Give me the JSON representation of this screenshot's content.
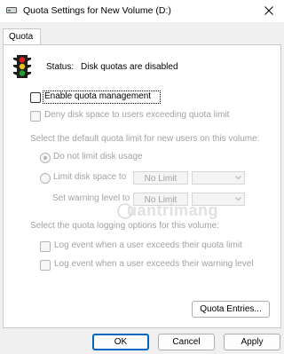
{
  "window": {
    "title": "Quota Settings for New Volume (D:)",
    "close_glyph": "✕",
    "title_icon": "drive-icon",
    "close_icon": "close-icon"
  },
  "tabs": [
    {
      "label": "Quota",
      "selected": true
    }
  ],
  "status": {
    "label": "Status:",
    "value": "Disk quotas are disabled",
    "icon": "traffic-light-icon"
  },
  "options": {
    "enable_quota": {
      "label": "Enable quota management",
      "checked": false
    },
    "deny_space": {
      "label": "Deny disk space to users exceeding quota limit",
      "checked": false
    }
  },
  "default_limit": {
    "section_label": "Select the default quota limit for new users on this volume:",
    "no_limit_radio": {
      "label": "Do not limit disk usage",
      "checked": true
    },
    "limit_radio": {
      "label": "Limit disk space to",
      "checked": false
    },
    "limit_value": "No Limit",
    "warning_label": "Set warning level to",
    "warning_value": "No Limit"
  },
  "logging": {
    "section_label": "Select the quota logging options for this volume:",
    "log_limit": {
      "label": "Log event when a user exceeds their quota limit",
      "checked": false
    },
    "log_warning": {
      "label": "Log event when a user exceeds their warning level",
      "checked": false
    }
  },
  "buttons": {
    "quota_entries": "Quota Entries...",
    "ok": "OK",
    "cancel": "Cancel",
    "apply": "Apply"
  },
  "watermark": "uantrimang",
  "colors": {
    "accent": "#0067c0",
    "disabled_text": "#a2a2a2",
    "panel_bg": "#ffffff",
    "window_bg": "#f0f0f0"
  }
}
